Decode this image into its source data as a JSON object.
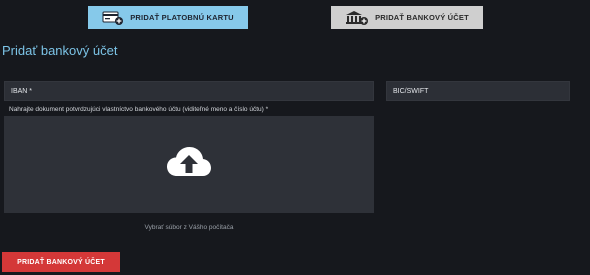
{
  "tabs": [
    {
      "label": "PRIDAŤ PLATOBNÚ KARTU",
      "icon": "credit-card-add-icon",
      "active": false,
      "color": "#86c9ea"
    },
    {
      "label": "PRIDAŤ BANKOVÝ ÚČET",
      "icon": "bank-add-icon",
      "active": true,
      "color": "#cfcfcf"
    }
  ],
  "form": {
    "title": "Pridať bankový účet",
    "iban_label": "IBAN *",
    "bic_label": "BIC/SWIFT",
    "upload_label": "Nahrajte dokument potvrdzujúci vlastníctvo bankového účtu (viditeľné meno a číslo účtu) *",
    "upload_icon": "cloud-upload-icon",
    "choose_file_label": "Vybrať súbor z Vášho počítača",
    "submit_label": "PRIDAŤ BANKOVÝ ÚČET"
  },
  "colors": {
    "background": "#16181d",
    "accent": "#7cc3e6",
    "submit": "#d43838"
  }
}
